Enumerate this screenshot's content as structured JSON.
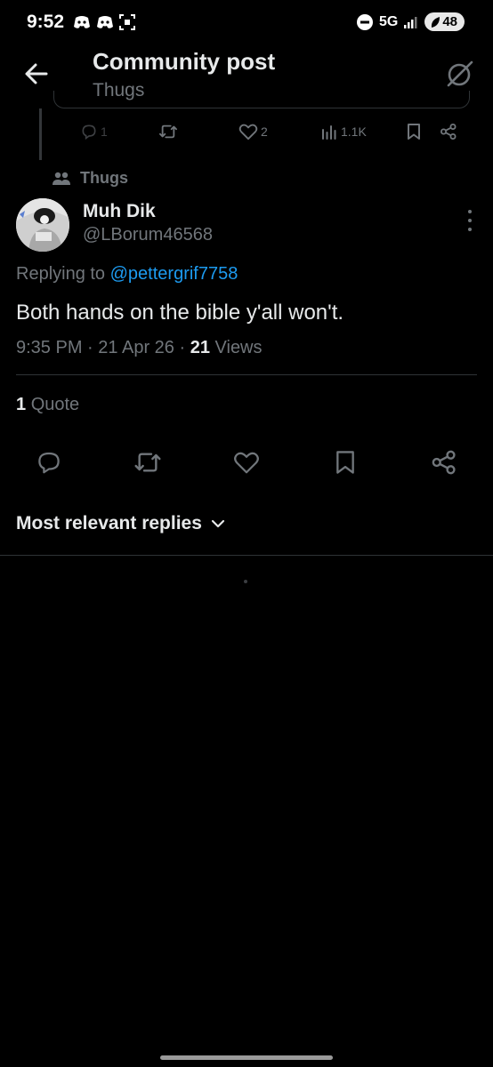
{
  "status_bar": {
    "time": "9:52",
    "network": "5G",
    "battery": "48",
    "notification_icons": [
      "discord-icon",
      "discord-icon",
      "screenshot-icon"
    ]
  },
  "header": {
    "title": "Community post",
    "subtitle": "Thugs",
    "back_icon": "arrow-left-icon",
    "right_icon": "grok-icon"
  },
  "parent_post": {
    "replies": "1",
    "likes": "2",
    "views": "1.1K"
  },
  "community": {
    "name": "Thugs"
  },
  "post": {
    "display_name": "Muh Dik",
    "handle": "@LBorum46568",
    "replying_prefix": "Replying to",
    "replying_to": "@pettergrif7758",
    "text": "Both hands on the bible y'all won't.",
    "time": "9:35 PM",
    "date": "21 Apr 26",
    "views_count": "21",
    "views_label": "Views",
    "separator": "·",
    "quote_count": "1",
    "quote_label": "Quote"
  },
  "replies_sort": {
    "label": "Most relevant replies"
  },
  "colors": {
    "background": "#000000",
    "text_primary": "#e7e9ea",
    "text_secondary": "#71767b",
    "accent": "#1d9bf0",
    "divider": "#2f3336"
  }
}
